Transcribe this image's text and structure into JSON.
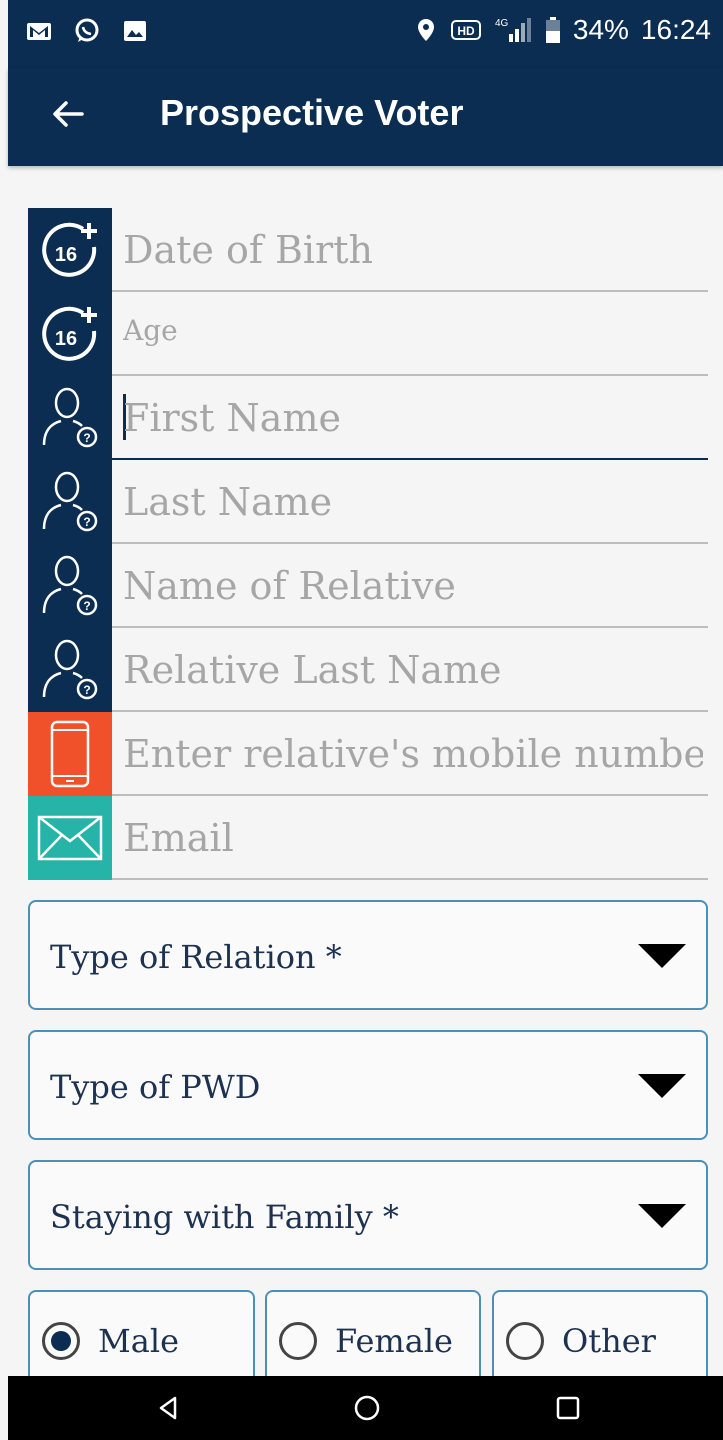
{
  "status_bar": {
    "battery": "34%",
    "time": "16:24",
    "icons_left": [
      "gmail-icon",
      "whatsapp-icon",
      "gallery-icon"
    ],
    "icons_right": [
      "location-icon",
      "hd-icon",
      "signal-icon",
      "battery-icon"
    ]
  },
  "app_bar": {
    "title": "Prospective Voter"
  },
  "form": {
    "fields": [
      {
        "placeholder": "Date of Birth",
        "icon": "age-16-plus-icon"
      },
      {
        "placeholder": "Age",
        "icon": "age-16-plus-icon"
      },
      {
        "placeholder": "First Name",
        "icon": "user-question-icon"
      },
      {
        "placeholder": "Last Name",
        "icon": "user-question-icon"
      },
      {
        "placeholder": "Name of Relative",
        "icon": "user-question-icon"
      },
      {
        "placeholder": "Relative Last Name",
        "icon": "user-question-icon"
      },
      {
        "placeholder": "Enter relative's mobile numbe",
        "icon": "mobile-phone-icon"
      },
      {
        "placeholder": "Email",
        "icon": "envelope-icon"
      }
    ],
    "dropdowns": [
      {
        "label": "Type of Relation *"
      },
      {
        "label": "Type of PWD"
      },
      {
        "label": "Staying with Family *"
      }
    ],
    "gender": {
      "options": [
        "Male",
        "Female",
        "Other"
      ],
      "selected": "Male"
    }
  },
  "colors": {
    "primary": "#0b2d52",
    "phone_accent": "#f0512b",
    "email_accent": "#26b3a8",
    "border": "#4a90b8"
  }
}
